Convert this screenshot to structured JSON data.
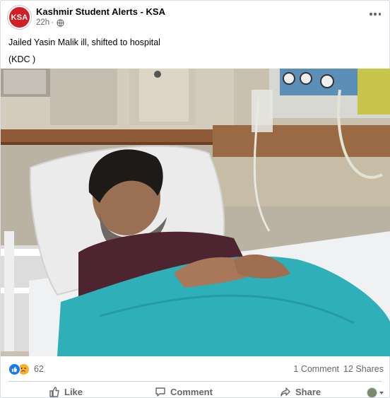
{
  "post": {
    "page_name": "Kashmir Student Alerts - KSA",
    "avatar_text": "KSA",
    "timestamp": "22h",
    "separator": "·",
    "audience_icon": "globe-icon",
    "more_icon": "more-horizontal-icon",
    "text_lines": [
      "Jailed Yasin Malik ill, shifted to hospital",
      "(KDC )"
    ]
  },
  "footer": {
    "reaction_icons": [
      "like-reaction-icon",
      "sad-reaction-icon"
    ],
    "reaction_count": "62",
    "comments": "1 Comment",
    "shares": "12 Shares"
  },
  "actions": {
    "like": "Like",
    "comment": "Comment",
    "share": "Share"
  },
  "colors": {
    "brand_red": "#d01f25",
    "facebook_blue": "#1877f2",
    "secondary_text": "#65676b",
    "blanket_teal": "#2fb0b8"
  }
}
